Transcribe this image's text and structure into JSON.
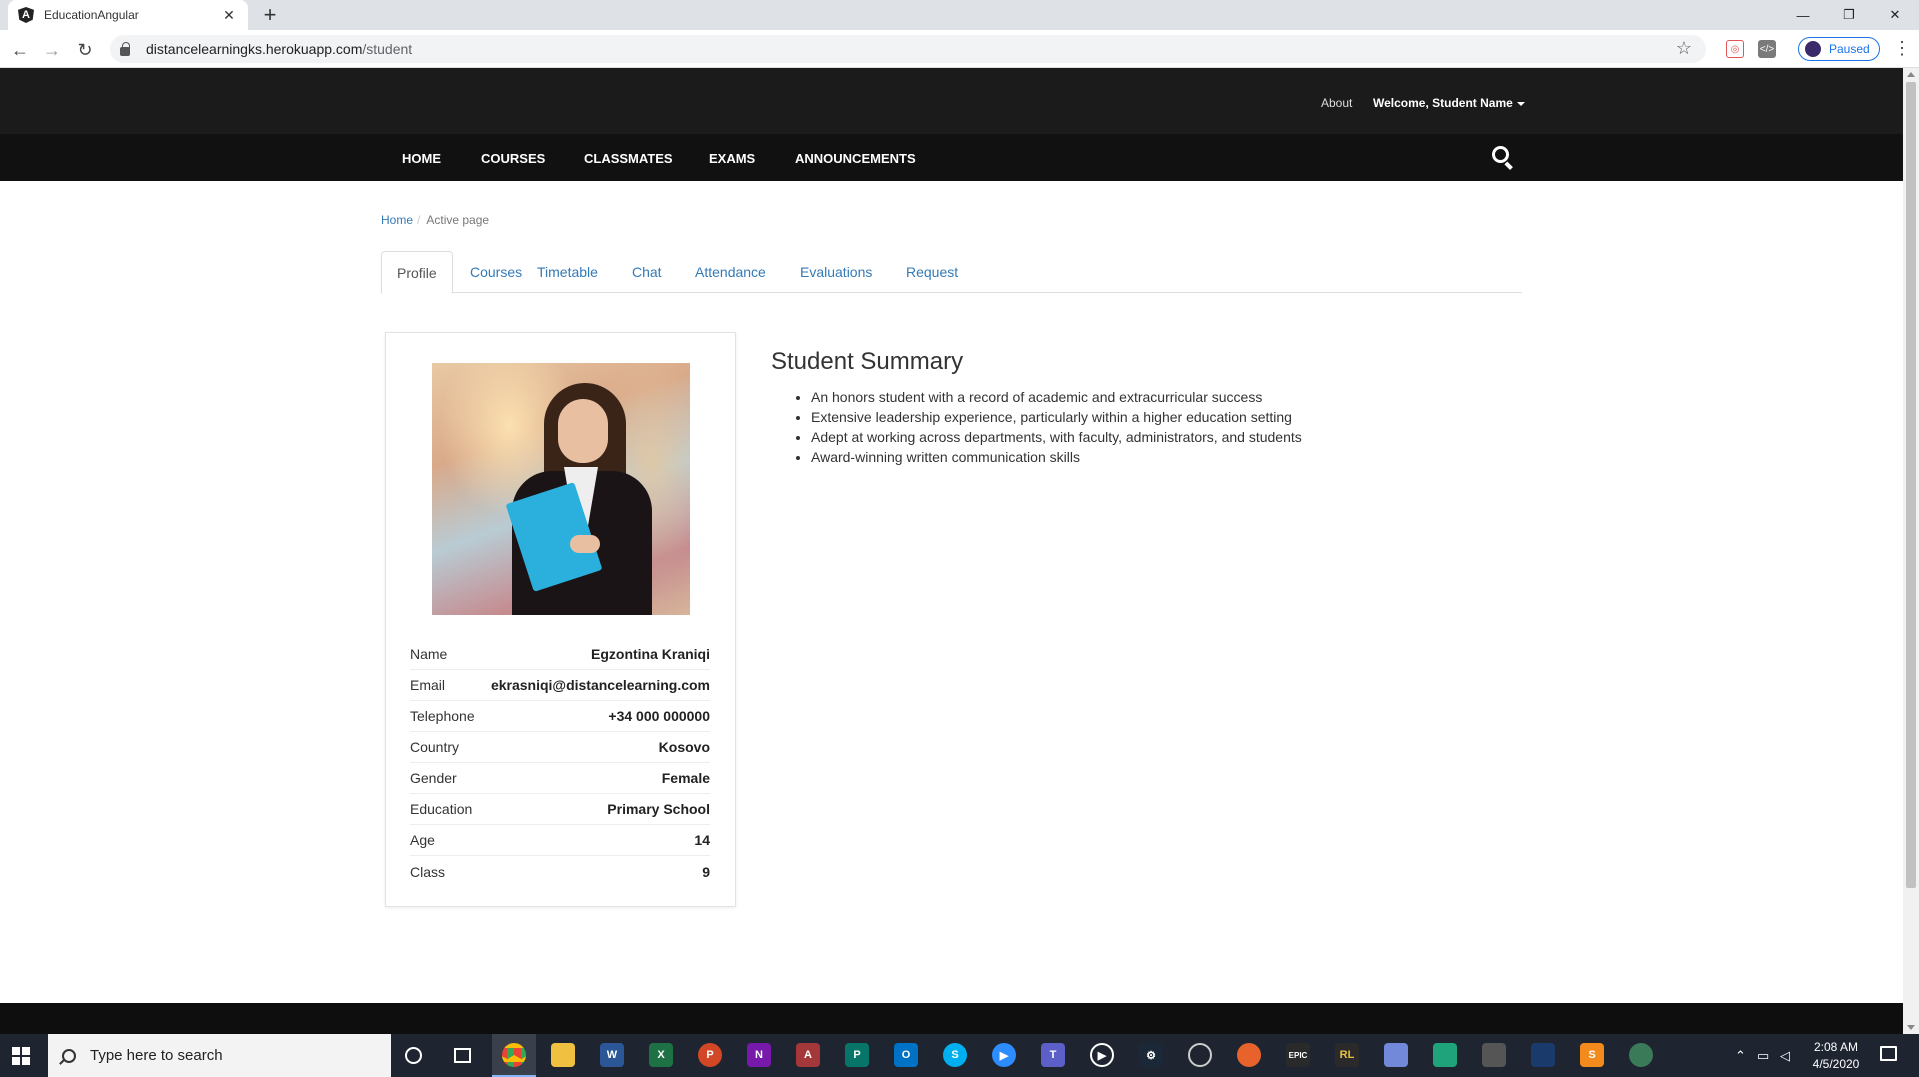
{
  "browser": {
    "tab_title": "EducationAngular",
    "url_host": "distancelearningks.herokuapp.com",
    "url_path": "/student",
    "profile_status": "Paused"
  },
  "site": {
    "top_links": {
      "about": "About",
      "welcome": "Welcome, Student Name"
    },
    "nav": [
      "HOME",
      "COURSES",
      "CLASSMATES",
      "EXAMS",
      "ANNOUNCEMENTS"
    ]
  },
  "breadcrumb": {
    "home": "Home",
    "active": "Active page"
  },
  "tabs": [
    "Profile",
    "Courses",
    "Timetable",
    "Chat",
    "Attendance",
    "Evaluations",
    "Request"
  ],
  "profile": {
    "fields": [
      {
        "label": "Name",
        "value": "Egzontina Kraniqi"
      },
      {
        "label": "Email",
        "value": "ekrasniqi@distancelearning.com"
      },
      {
        "label": "Telephone",
        "value": "+34 000 000000"
      },
      {
        "label": "Country",
        "value": "Kosovo"
      },
      {
        "label": "Gender",
        "value": "Female"
      },
      {
        "label": "Education",
        "value": "Primary School"
      },
      {
        "label": "Age",
        "value": "14"
      },
      {
        "label": "Class",
        "value": "9"
      }
    ]
  },
  "summary": {
    "title": "Student Summary",
    "items": [
      "An honors student with a record of academic and extracurricular success",
      "Extensive leadership experience, particularly within a higher education setting",
      "Adept at working across departments, with faculty, administrators, and students",
      "Award-winning written communication skills"
    ]
  },
  "taskbar": {
    "search_placeholder": "Type here to search",
    "time": "2:08 AM",
    "date": "4/5/2020"
  },
  "colors": {
    "header_bg": "#1b1b1b",
    "nav_bg": "#111111",
    "link": "#337ab7"
  }
}
